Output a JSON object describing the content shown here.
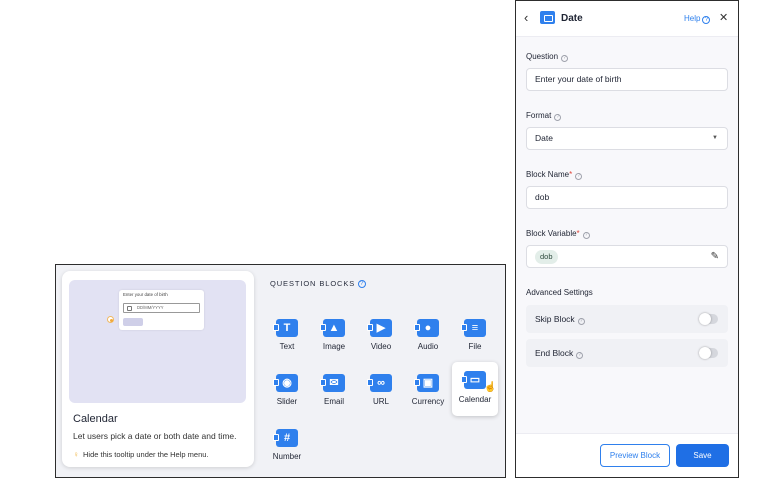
{
  "tooltip": {
    "preview_title": "Enter your date of birth",
    "preview_placeholder": "DD/MM/YYYY",
    "title": "Calendar",
    "description": "Let users pick a date or both date and time.",
    "hint": "Hide this tooltip under the Help menu."
  },
  "question_blocks": {
    "header": "QUESTION BLOCKS",
    "items": [
      {
        "label": "Text",
        "icon": "text-icon"
      },
      {
        "label": "Image",
        "icon": "image-icon"
      },
      {
        "label": "Video",
        "icon": "video-icon"
      },
      {
        "label": "Audio",
        "icon": "microphone-icon"
      },
      {
        "label": "File",
        "icon": "file-icon"
      },
      {
        "label": "Slider",
        "icon": "slider-icon"
      },
      {
        "label": "Email",
        "icon": "email-icon"
      },
      {
        "label": "URL",
        "icon": "link-icon"
      },
      {
        "label": "Currency",
        "icon": "wallet-icon"
      },
      {
        "label": "Calendar",
        "icon": "calendar-icon"
      },
      {
        "label": "Number",
        "icon": "hash-icon"
      }
    ]
  },
  "panel": {
    "title": "Date",
    "help": "Help",
    "question_label": "Question",
    "question_value": "Enter your date of birth",
    "format_label": "Format",
    "format_value": "Date",
    "block_name_label": "Block Name",
    "block_name_value": "dob",
    "block_variable_label": "Block Variable",
    "block_variable_value": "dob",
    "advanced_label": "Advanced Settings",
    "skip_block_label": "Skip Block",
    "end_block_label": "End Block",
    "preview_button": "Preview Block",
    "save_button": "Save"
  },
  "colors": {
    "accent": "#2f80ed",
    "save": "#1f6fe5",
    "required": "#e0453a"
  }
}
